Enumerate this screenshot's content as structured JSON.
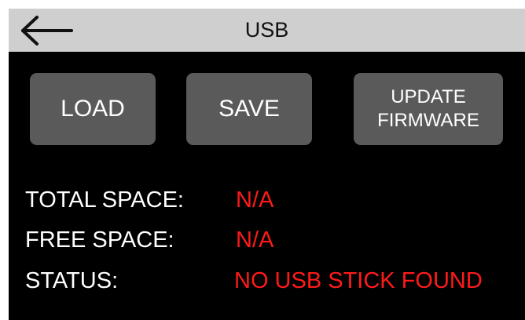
{
  "header": {
    "back_icon": "arrow-left-icon",
    "title": "USB"
  },
  "buttons": {
    "load_label": "LOAD",
    "save_label": "SAVE",
    "update_firmware_line1": "UPDATE",
    "update_firmware_line2": "FIRMWARE"
  },
  "info": {
    "total_space_label": "TOTAL SPACE:",
    "total_space_value": "N/A",
    "free_space_label": "FREE SPACE:",
    "free_space_value": "N/A",
    "status_label": "STATUS:",
    "status_value": "NO USB STICK FOUND"
  },
  "colors": {
    "header_bg": "#cfcfcf",
    "screen_bg": "#000000",
    "button_bg": "#5a5a5a",
    "value_text": "#ff1a1a",
    "label_text": "#ffffff"
  }
}
